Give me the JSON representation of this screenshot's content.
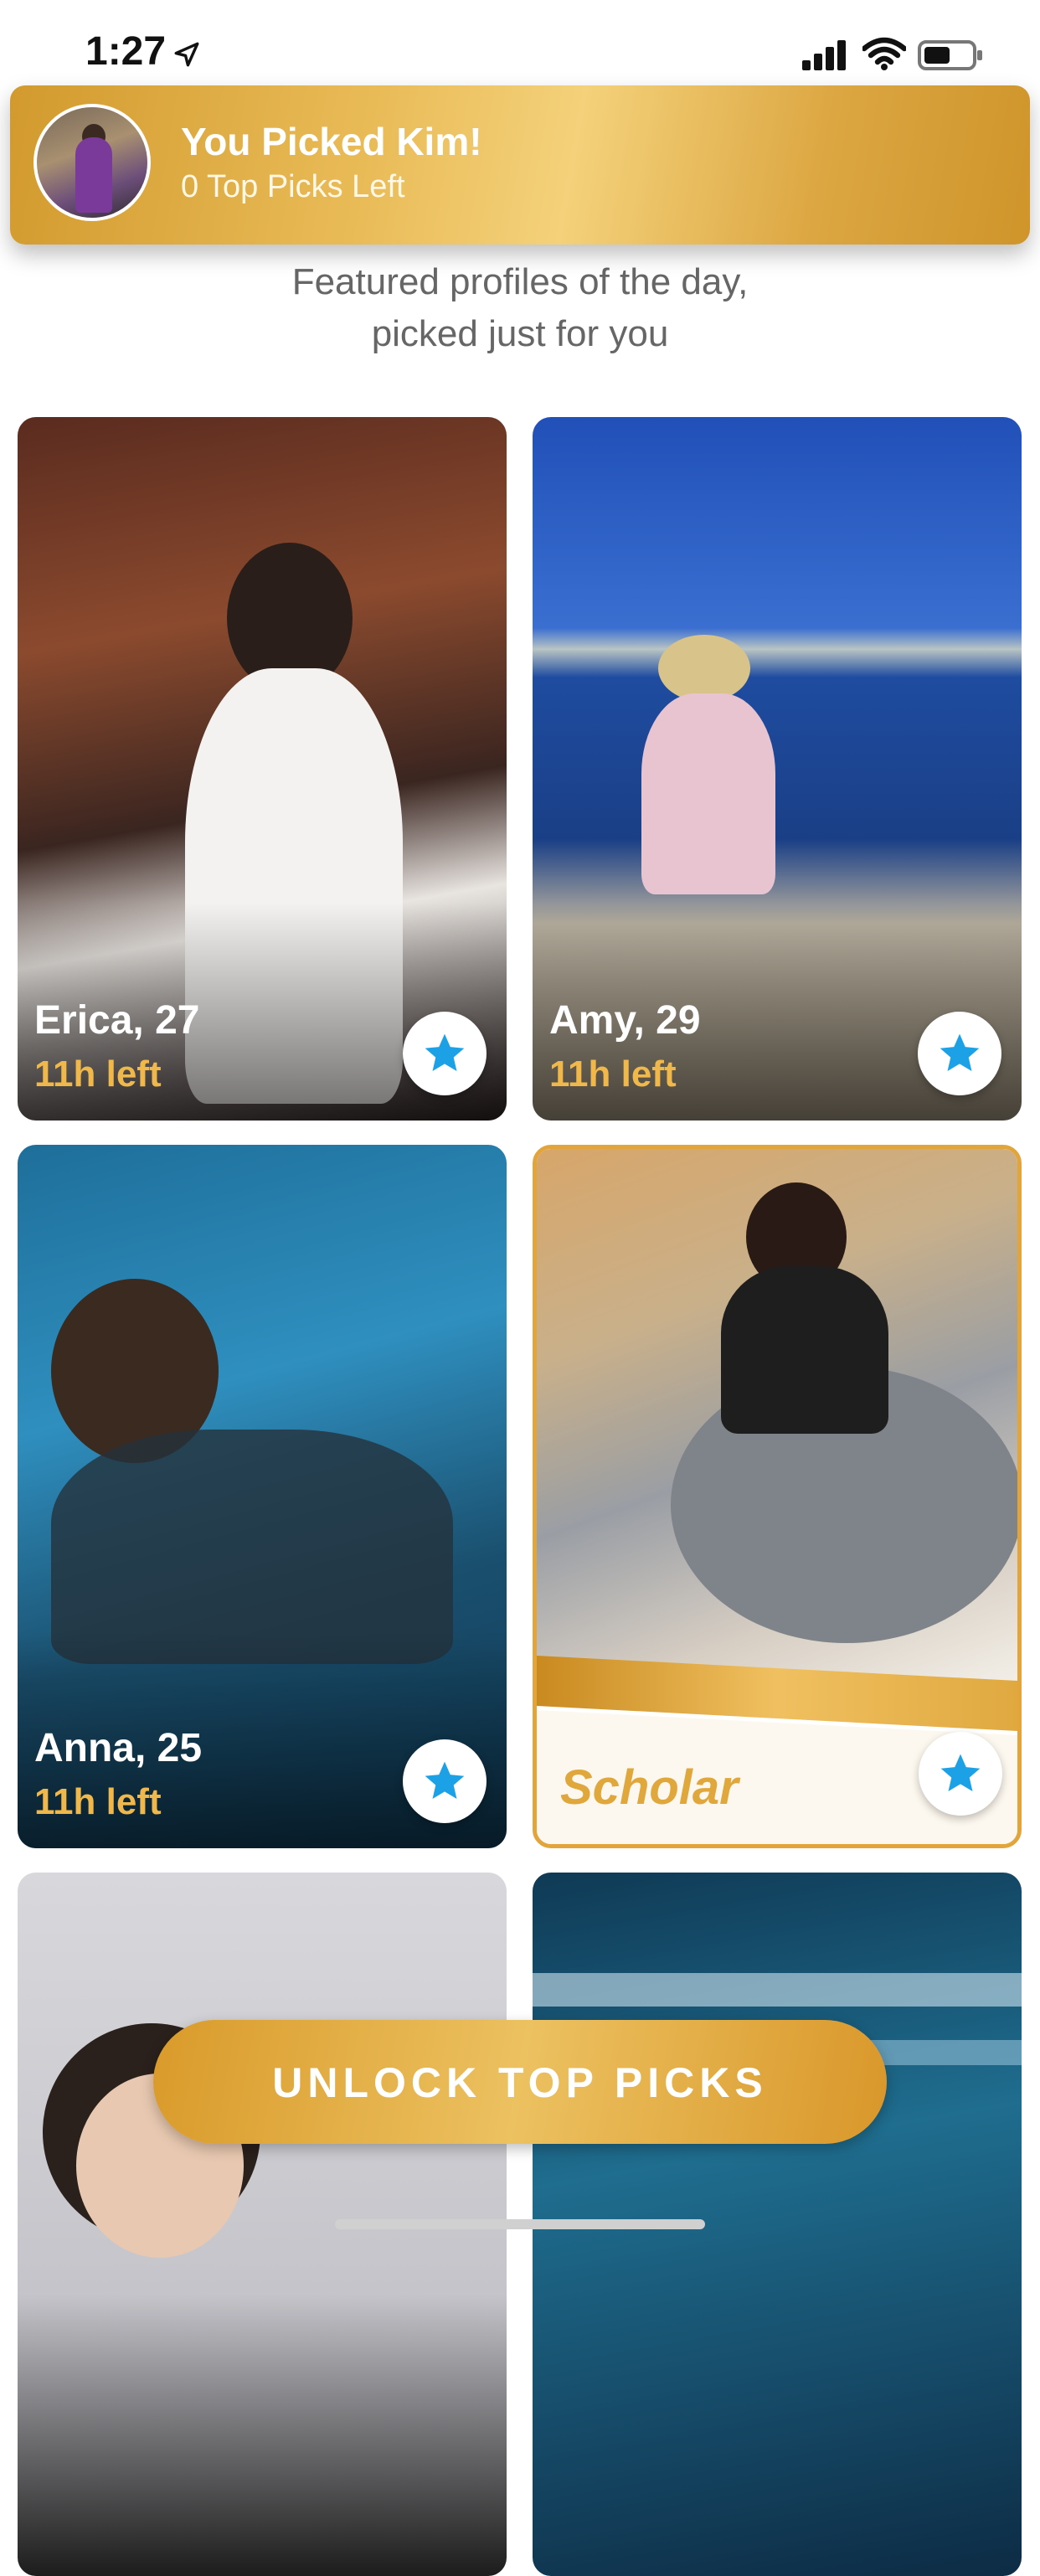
{
  "status_bar": {
    "time": "1:27"
  },
  "banner": {
    "title": "You Picked Kim!",
    "subtitle": "0 Top Picks Left"
  },
  "intro": {
    "line1": "Featured profiles of the day,",
    "line2": "picked just for you"
  },
  "cards": [
    {
      "name": "Erica, 27",
      "time_left": "11h left"
    },
    {
      "name": "Amy, 29",
      "time_left": "11h left"
    },
    {
      "name": "Anna, 25",
      "time_left": "11h left"
    },
    {
      "label": "Scholar"
    },
    {},
    {}
  ],
  "unlock_button": {
    "label": "UNLOCK TOP PICKS"
  },
  "colors": {
    "gold": "#e2a53c",
    "star_blue": "#1da1e6",
    "time_gold": "#f0b84a"
  },
  "icons": [
    "location-arrow-icon",
    "signal-icon",
    "wifi-icon",
    "battery-icon",
    "star-icon"
  ]
}
